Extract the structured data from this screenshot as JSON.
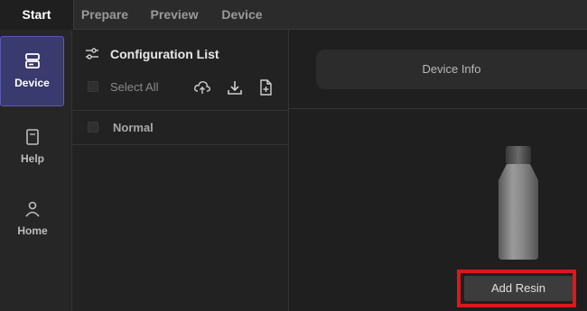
{
  "tabs": [
    {
      "label": "Start",
      "active": true
    },
    {
      "label": "Prepare",
      "active": false
    },
    {
      "label": "Preview",
      "active": false
    },
    {
      "label": "Device",
      "active": false
    }
  ],
  "leftnav": {
    "items": [
      {
        "label": "Device",
        "icon": "printer-icon",
        "active": true
      },
      {
        "label": "Help",
        "icon": "book-icon",
        "active": false
      },
      {
        "label": "Home",
        "icon": "user-icon",
        "active": false
      }
    ]
  },
  "config": {
    "title": "Configuration List",
    "select_all_label": "Select All",
    "items": [
      {
        "label": "Normal",
        "checked": false
      }
    ],
    "tool_icons": [
      "cloud-upload-icon",
      "download-icon",
      "new-file-icon"
    ]
  },
  "main": {
    "device_info_label": "Device Info",
    "add_resin_label": "Add Resin"
  },
  "colors": {
    "accent_nav": "#3a3a6e",
    "highlight": "#e0161b",
    "background": "#1e1e1e"
  }
}
